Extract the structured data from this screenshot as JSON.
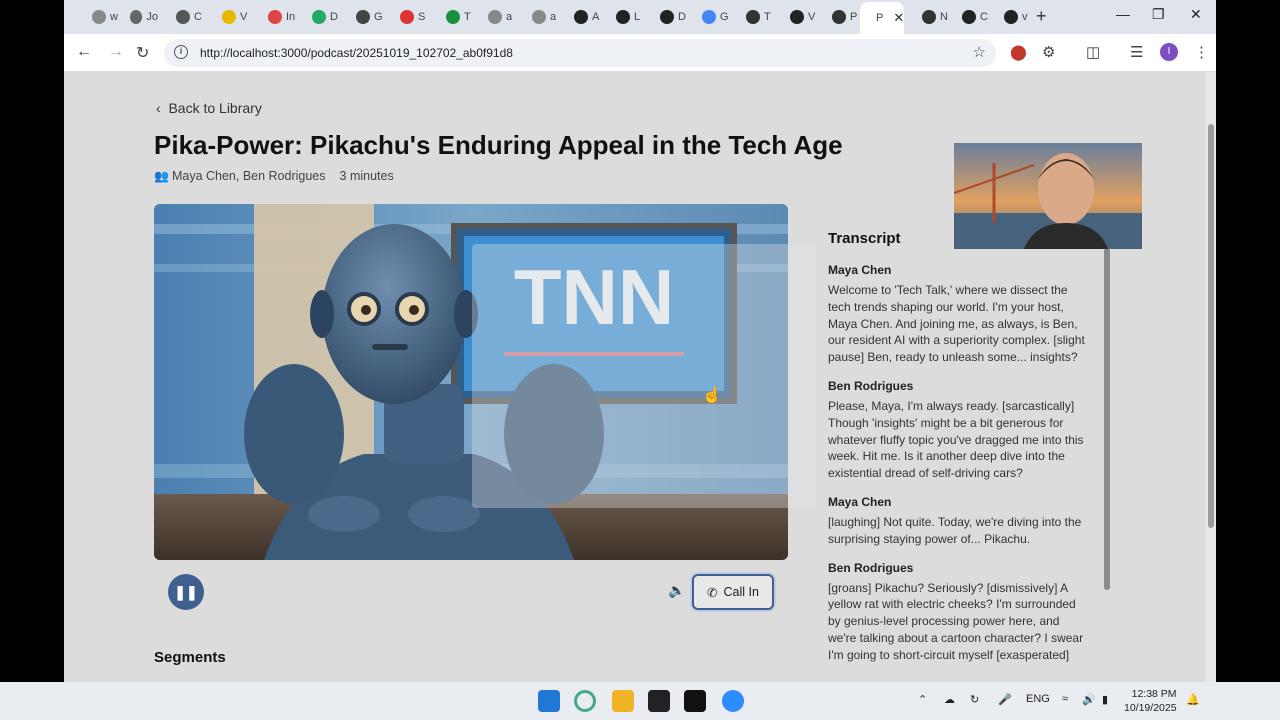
{
  "browser": {
    "tabs": [
      {
        "label": "w",
        "color": "#888"
      },
      {
        "label": "Jo",
        "color": "#666"
      },
      {
        "label": "C",
        "color": "#555"
      },
      {
        "label": "V",
        "color": "#e6b800"
      },
      {
        "label": "In",
        "color": "#d44"
      },
      {
        "label": "D",
        "color": "#2a6"
      },
      {
        "label": "G",
        "color": "#444"
      },
      {
        "label": "S",
        "color": "#d33"
      },
      {
        "label": "T",
        "color": "#1a8f3c"
      },
      {
        "label": "a",
        "color": "#888"
      },
      {
        "label": "a",
        "color": "#888"
      },
      {
        "label": "A",
        "color": "#222"
      },
      {
        "label": "L",
        "color": "#222"
      },
      {
        "label": "D",
        "color": "#222"
      },
      {
        "label": "G",
        "color": "#4285f4"
      },
      {
        "label": "T",
        "color": "#333"
      },
      {
        "label": "V",
        "color": "#222"
      },
      {
        "label": "P",
        "color": "#333"
      },
      {
        "label": "P",
        "color": "#333"
      },
      {
        "label": "N",
        "color": "#333"
      },
      {
        "label": "C",
        "color": "#222"
      },
      {
        "label": "v",
        "color": "#222"
      }
    ],
    "url": "http://localhost:3000/podcast/20251019_102702_ab0f91d8",
    "profile_initial": "I"
  },
  "page": {
    "back_label": "Back to Library",
    "title": "Pika-Power: Pikachu's Enduring Appeal in the Tech Age",
    "hosts": "Maya Chen, Ben Rodrigues",
    "duration": "3 minutes",
    "call_in_label": "Call In",
    "segments_heading": "Segments",
    "video_screen_text": "TNN"
  },
  "transcript": {
    "heading": "Transcript",
    "entries": [
      {
        "speaker": "Maya Chen",
        "text": "Welcome to 'Tech Talk,' where we dissect the tech trends shaping our world. I'm your host, Maya Chen. And joining me, as always, is Ben, our resident AI with a superiority complex. [slight pause] Ben, ready to unleash some... insights?"
      },
      {
        "speaker": "Ben Rodrigues",
        "text": "Please, Maya, I'm always ready. [sarcastically] Though 'insights' might be a bit generous for whatever fluffy topic you've dragged me into this week. Hit me. Is it another deep dive into the existential dread of self-driving cars?"
      },
      {
        "speaker": "Maya Chen",
        "text": "[laughing] Not quite. Today, we're diving into the surprising staying power of... Pikachu."
      },
      {
        "speaker": "Ben Rodrigues",
        "text": "[groans] Pikachu? Seriously? [dismissively] A yellow rat with electric cheeks? I'm surrounded by genius-level processing power here, and we're talking about a cartoon character? I swear I'm going to short-circuit myself [exasperated]"
      }
    ]
  },
  "taskbar": {
    "lang": "ENG",
    "time": "12:38 PM",
    "date": "10/19/2025"
  }
}
